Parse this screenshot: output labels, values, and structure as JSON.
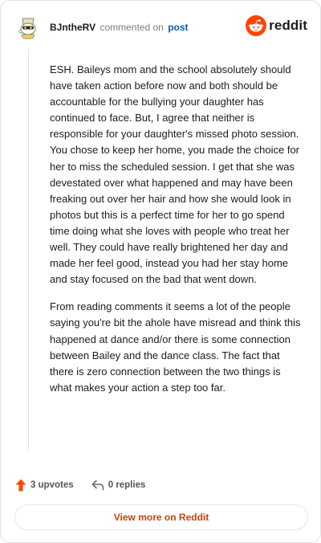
{
  "header": {
    "author": "BJntheRV",
    "commented_on": "commented on",
    "post_link": "post",
    "brand_word": "reddit"
  },
  "comment": {
    "paragraphs": [
      "ESH. Baileys mom and the school absolutely should have taken action before now and both should be accountable for the bullying your daughter has continued to face. But, I agree that neither is responsible for your daughter's missed photo session. You chose to keep her home, you made the choice for her to miss the scheduled session. I get that she was devestated over what happened and may have been freaking out over her hair and how she would look in photos but this is a perfect time for her to go spend time doing what she loves with people who treat her well. They could have really brightened her day and made her feel good, instead you had her stay home and stay focused on the bad that went down.",
      "From reading comments it seems a lot of the people saying you're bit the ahole have misread and think this happened at dance and/or there is some connection between Bailey and the dance class. The fact that there is zero connection between the two things is what makes your action a step too far."
    ]
  },
  "footer": {
    "upvotes": "3 upvotes",
    "replies": "0 replies"
  },
  "view_more": "View more on Reddit",
  "colors": {
    "reddit_orange": "#ff4500",
    "link_blue": "#0a57b8",
    "cta_text": "#c6420b"
  },
  "icons": {
    "avatar": "snoo-avatar",
    "brand": "reddit-logo-icon",
    "upvote": "upvote-arrow-icon",
    "reply": "reply-arrow-icon"
  }
}
